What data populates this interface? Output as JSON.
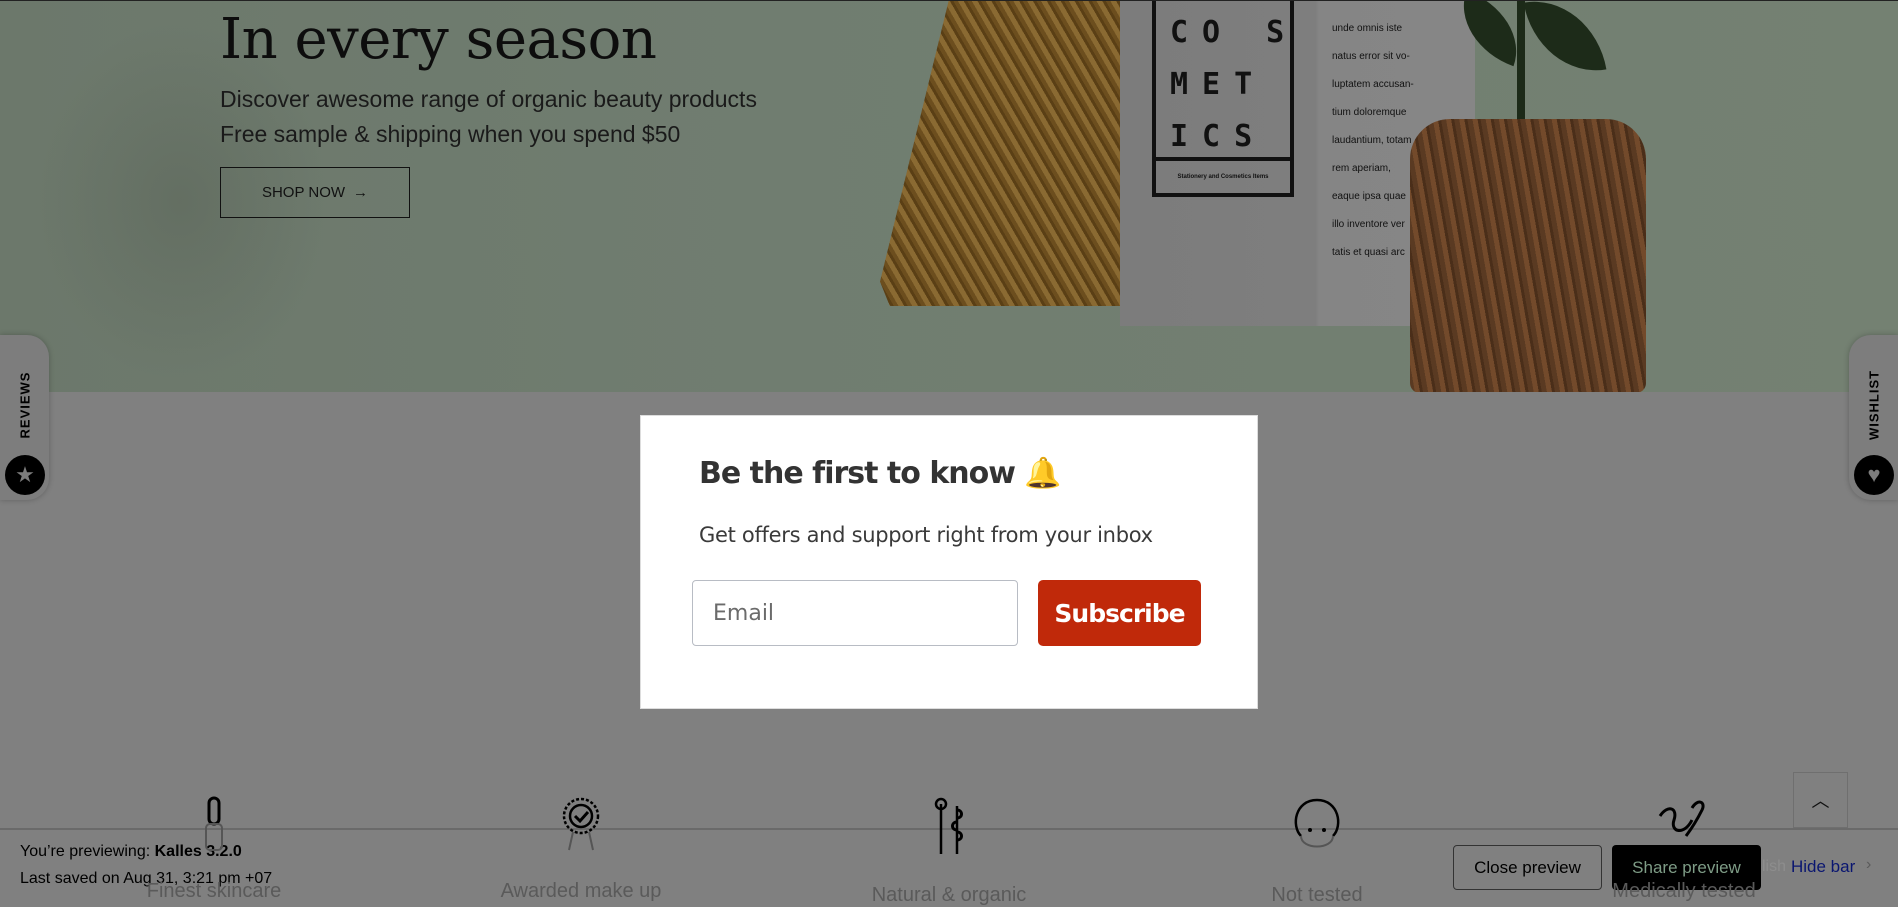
{
  "hero": {
    "title": "In every season",
    "subtitle_1": "Discover awesome range of organic beauty products",
    "subtitle_2": "Free sample & shipping when you spend $50",
    "cta_label": "SHOP NOW",
    "cta_icon": "arrow-right-icon",
    "box_letters": "CO S\nMET\nICS",
    "box_footer": "Stationery and Cosmetics Items",
    "box_lorem": [
      "unde omnis iste",
      "natus error sit vo-",
      "luptatem accusan-",
      "tium doloremque",
      "laudantium, totam",
      "rem aperiam,",
      "eaque ipsa quae",
      "illo inventore ver",
      "tatis et quasi arc"
    ]
  },
  "side_tabs": {
    "reviews": {
      "label": "REVIEWS",
      "icon": "star-icon"
    },
    "wishlist": {
      "label": "WISHLIST",
      "icon": "heart-icon"
    }
  },
  "popup": {
    "title": "Be the first to know 🔔",
    "subtitle": "Get offers and support right from your inbox",
    "email_placeholder": "Email",
    "email_value": "",
    "subscribe_label": "Subscribe",
    "accent_color": "#c0290a"
  },
  "features": [
    {
      "label": "Finest skincare",
      "icon": "serum-bottle-icon"
    },
    {
      "label": "Awarded make up",
      "icon": "award-badge-icon"
    },
    {
      "label": "Natural & organic",
      "icon": "plant-icon"
    },
    {
      "label": "Not tested",
      "icon": "bunny-icon"
    },
    {
      "label": "Medically tested",
      "icon": "hands-icon"
    }
  ],
  "back_to_top": {
    "icon": "chevron-up-icon"
  },
  "preview_bar": {
    "previewing_prefix": "You’re previewing: ",
    "theme_name": "Kalles 3.2.0",
    "last_saved": "Last saved on Aug 31, 3:21 pm +07",
    "close_label": "Close preview",
    "share_label": "Share preview",
    "publish_partial": "lish",
    "hide_label": "Hide bar"
  }
}
